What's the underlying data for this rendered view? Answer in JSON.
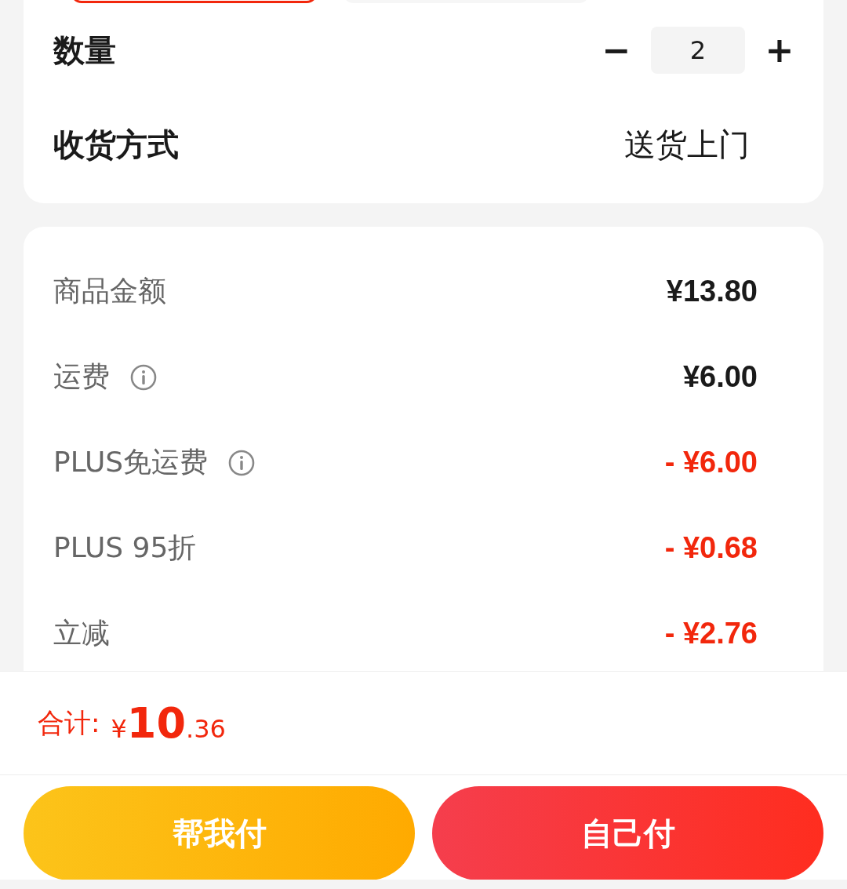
{
  "options": [
    {
      "selected": true
    },
    {
      "selected": false
    }
  ],
  "quantity": {
    "label": "数量",
    "minus": "−",
    "value": "2",
    "plus": "+"
  },
  "delivery": {
    "label": "收货方式",
    "value": "送货上门"
  },
  "fees": [
    {
      "label": "商品金额",
      "info": false,
      "kind": "normal",
      "value": "¥13.80"
    },
    {
      "label": "运费",
      "info": true,
      "kind": "normal",
      "value": "¥6.00"
    },
    {
      "label": "PLUS免运费",
      "info": true,
      "kind": "discount",
      "value": "- ¥6.00"
    },
    {
      "label": "PLUS 95折",
      "info": false,
      "kind": "discount",
      "value": "- ¥0.68"
    },
    {
      "label": "立减",
      "info": false,
      "kind": "discount",
      "value": "- ¥2.76"
    }
  ],
  "total": {
    "label": "合计:",
    "currency": "¥",
    "integer": "10",
    "decimal": ".36"
  },
  "buttons": [
    {
      "kind": "gold",
      "label": "帮我付"
    },
    {
      "kind": "red",
      "label": "自己付"
    }
  ]
}
